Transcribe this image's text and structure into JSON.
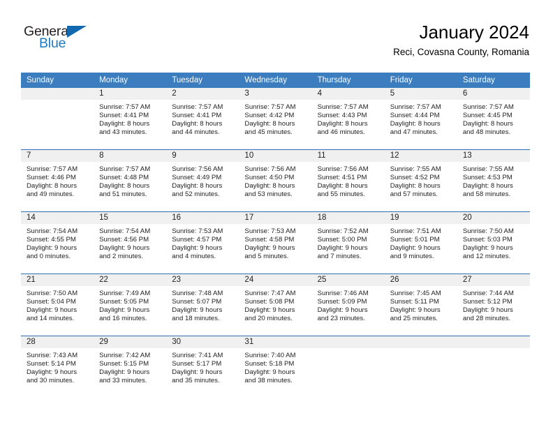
{
  "brand": {
    "name_part1": "General",
    "name_part2": "Blue",
    "accent_color": "#1269b0"
  },
  "header": {
    "title": "January 2024",
    "subtitle": "Reci, Covasna County, Romania"
  },
  "calendar": {
    "header_color": "#3b7dbf",
    "row_divider_color": "#2f6fae",
    "daynum_band_color": "#f0f0f0",
    "weekday_headers": [
      "Sunday",
      "Monday",
      "Tuesday",
      "Wednesday",
      "Thursday",
      "Friday",
      "Saturday"
    ],
    "weeks": [
      [
        {
          "day": "",
          "lines": []
        },
        {
          "day": "1",
          "lines": [
            "Sunrise: 7:57 AM",
            "Sunset: 4:41 PM",
            "Daylight: 8 hours",
            "and 43 minutes."
          ]
        },
        {
          "day": "2",
          "lines": [
            "Sunrise: 7:57 AM",
            "Sunset: 4:41 PM",
            "Daylight: 8 hours",
            "and 44 minutes."
          ]
        },
        {
          "day": "3",
          "lines": [
            "Sunrise: 7:57 AM",
            "Sunset: 4:42 PM",
            "Daylight: 8 hours",
            "and 45 minutes."
          ]
        },
        {
          "day": "4",
          "lines": [
            "Sunrise: 7:57 AM",
            "Sunset: 4:43 PM",
            "Daylight: 8 hours",
            "and 46 minutes."
          ]
        },
        {
          "day": "5",
          "lines": [
            "Sunrise: 7:57 AM",
            "Sunset: 4:44 PM",
            "Daylight: 8 hours",
            "and 47 minutes."
          ]
        },
        {
          "day": "6",
          "lines": [
            "Sunrise: 7:57 AM",
            "Sunset: 4:45 PM",
            "Daylight: 8 hours",
            "and 48 minutes."
          ]
        }
      ],
      [
        {
          "day": "7",
          "lines": [
            "Sunrise: 7:57 AM",
            "Sunset: 4:46 PM",
            "Daylight: 8 hours",
            "and 49 minutes."
          ]
        },
        {
          "day": "8",
          "lines": [
            "Sunrise: 7:57 AM",
            "Sunset: 4:48 PM",
            "Daylight: 8 hours",
            "and 51 minutes."
          ]
        },
        {
          "day": "9",
          "lines": [
            "Sunrise: 7:56 AM",
            "Sunset: 4:49 PM",
            "Daylight: 8 hours",
            "and 52 minutes."
          ]
        },
        {
          "day": "10",
          "lines": [
            "Sunrise: 7:56 AM",
            "Sunset: 4:50 PM",
            "Daylight: 8 hours",
            "and 53 minutes."
          ]
        },
        {
          "day": "11",
          "lines": [
            "Sunrise: 7:56 AM",
            "Sunset: 4:51 PM",
            "Daylight: 8 hours",
            "and 55 minutes."
          ]
        },
        {
          "day": "12",
          "lines": [
            "Sunrise: 7:55 AM",
            "Sunset: 4:52 PM",
            "Daylight: 8 hours",
            "and 57 minutes."
          ]
        },
        {
          "day": "13",
          "lines": [
            "Sunrise: 7:55 AM",
            "Sunset: 4:53 PM",
            "Daylight: 8 hours",
            "and 58 minutes."
          ]
        }
      ],
      [
        {
          "day": "14",
          "lines": [
            "Sunrise: 7:54 AM",
            "Sunset: 4:55 PM",
            "Daylight: 9 hours",
            "and 0 minutes."
          ]
        },
        {
          "day": "15",
          "lines": [
            "Sunrise: 7:54 AM",
            "Sunset: 4:56 PM",
            "Daylight: 9 hours",
            "and 2 minutes."
          ]
        },
        {
          "day": "16",
          "lines": [
            "Sunrise: 7:53 AM",
            "Sunset: 4:57 PM",
            "Daylight: 9 hours",
            "and 4 minutes."
          ]
        },
        {
          "day": "17",
          "lines": [
            "Sunrise: 7:53 AM",
            "Sunset: 4:58 PM",
            "Daylight: 9 hours",
            "and 5 minutes."
          ]
        },
        {
          "day": "18",
          "lines": [
            "Sunrise: 7:52 AM",
            "Sunset: 5:00 PM",
            "Daylight: 9 hours",
            "and 7 minutes."
          ]
        },
        {
          "day": "19",
          "lines": [
            "Sunrise: 7:51 AM",
            "Sunset: 5:01 PM",
            "Daylight: 9 hours",
            "and 9 minutes."
          ]
        },
        {
          "day": "20",
          "lines": [
            "Sunrise: 7:50 AM",
            "Sunset: 5:03 PM",
            "Daylight: 9 hours",
            "and 12 minutes."
          ]
        }
      ],
      [
        {
          "day": "21",
          "lines": [
            "Sunrise: 7:50 AM",
            "Sunset: 5:04 PM",
            "Daylight: 9 hours",
            "and 14 minutes."
          ]
        },
        {
          "day": "22",
          "lines": [
            "Sunrise: 7:49 AM",
            "Sunset: 5:05 PM",
            "Daylight: 9 hours",
            "and 16 minutes."
          ]
        },
        {
          "day": "23",
          "lines": [
            "Sunrise: 7:48 AM",
            "Sunset: 5:07 PM",
            "Daylight: 9 hours",
            "and 18 minutes."
          ]
        },
        {
          "day": "24",
          "lines": [
            "Sunrise: 7:47 AM",
            "Sunset: 5:08 PM",
            "Daylight: 9 hours",
            "and 20 minutes."
          ]
        },
        {
          "day": "25",
          "lines": [
            "Sunrise: 7:46 AM",
            "Sunset: 5:09 PM",
            "Daylight: 9 hours",
            "and 23 minutes."
          ]
        },
        {
          "day": "26",
          "lines": [
            "Sunrise: 7:45 AM",
            "Sunset: 5:11 PM",
            "Daylight: 9 hours",
            "and 25 minutes."
          ]
        },
        {
          "day": "27",
          "lines": [
            "Sunrise: 7:44 AM",
            "Sunset: 5:12 PM",
            "Daylight: 9 hours",
            "and 28 minutes."
          ]
        }
      ],
      [
        {
          "day": "28",
          "lines": [
            "Sunrise: 7:43 AM",
            "Sunset: 5:14 PM",
            "Daylight: 9 hours",
            "and 30 minutes."
          ]
        },
        {
          "day": "29",
          "lines": [
            "Sunrise: 7:42 AM",
            "Sunset: 5:15 PM",
            "Daylight: 9 hours",
            "and 33 minutes."
          ]
        },
        {
          "day": "30",
          "lines": [
            "Sunrise: 7:41 AM",
            "Sunset: 5:17 PM",
            "Daylight: 9 hours",
            "and 35 minutes."
          ]
        },
        {
          "day": "31",
          "lines": [
            "Sunrise: 7:40 AM",
            "Sunset: 5:18 PM",
            "Daylight: 9 hours",
            "and 38 minutes."
          ]
        },
        {
          "day": "",
          "lines": []
        },
        {
          "day": "",
          "lines": []
        },
        {
          "day": "",
          "lines": []
        }
      ]
    ]
  }
}
